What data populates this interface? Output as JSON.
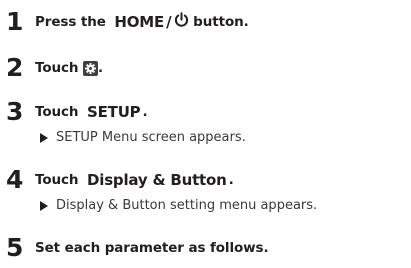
{
  "steps": [
    {
      "number": "1",
      "before": "Press the ",
      "keyword": "HOME",
      "separator": "/",
      "icon": "power-icon",
      "after": " button."
    },
    {
      "number": "2",
      "before": "Touch ",
      "icon": "settings-gear-icon",
      "after": "."
    },
    {
      "number": "3",
      "before": "Touch ",
      "keyword": "SETUP",
      "after": ".",
      "result": "SETUP Menu screen appears."
    },
    {
      "number": "4",
      "before": "Touch ",
      "keyword": "Display & Button",
      "after": ".",
      "result": "Display & Button setting menu appears."
    },
    {
      "number": "5",
      "text": "Set each parameter as follows."
    }
  ]
}
